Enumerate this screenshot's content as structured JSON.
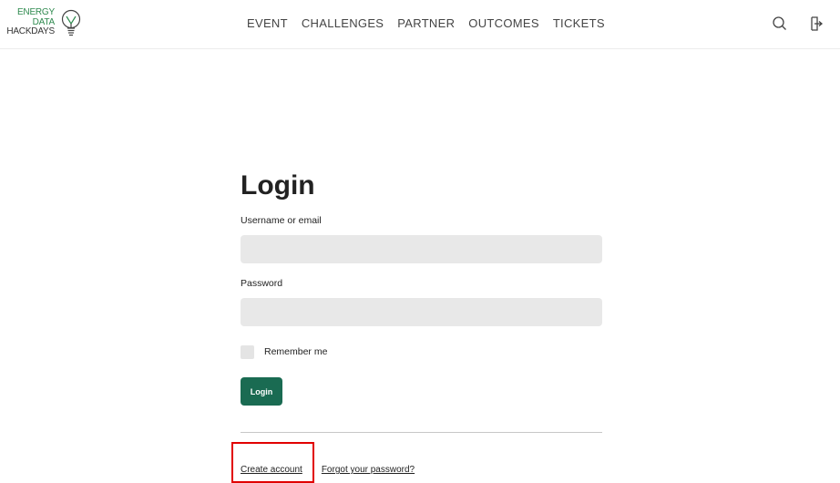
{
  "header": {
    "logo": {
      "line1": "ENERGY",
      "line2": "DATA",
      "line3": "HACKDAYS",
      "icon": "lightbulb-icon"
    },
    "nav": [
      {
        "label": "EVENT"
      },
      {
        "label": "CHALLENGES"
      },
      {
        "label": "PARTNER"
      },
      {
        "label": "OUTCOMES"
      },
      {
        "label": "TICKETS"
      }
    ],
    "icons": {
      "search": "search-icon",
      "login": "login-icon"
    }
  },
  "login_form": {
    "title": "Login",
    "username_label": "Username or email",
    "username_value": "",
    "password_label": "Password",
    "password_value": "",
    "remember_label": "Remember me",
    "remember_checked": false,
    "submit_label": "Login",
    "create_account_label": "Create account",
    "forgot_password_label": "Forgot your password?"
  },
  "colors": {
    "accent": "#1a6b52",
    "logo_green": "#2f8a4f",
    "input_bg": "#e8e8e8",
    "highlight": "#e10000"
  }
}
